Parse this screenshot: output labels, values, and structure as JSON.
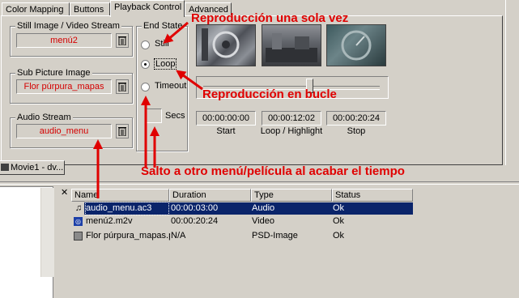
{
  "tabs": [
    {
      "label": "Color Mapping"
    },
    {
      "label": "Buttons"
    },
    {
      "label": "Playback Control"
    },
    {
      "label": "Advanced"
    }
  ],
  "groups": {
    "still": {
      "title": "Still Image / Video Stream",
      "value": "menú2"
    },
    "subpic": {
      "title": "Sub Picture Image",
      "value": "Flor púrpura_mapas"
    },
    "audio": {
      "title": "Audio Stream",
      "value": "audio_menu"
    }
  },
  "end_state": {
    "title": "End State",
    "options": [
      "Still",
      "Loop",
      "Timeout"
    ],
    "selected": "Loop",
    "secs_label": "Secs"
  },
  "times": {
    "start": {
      "value": "00:00:00:00",
      "label": "Start"
    },
    "loop": {
      "value": "00:00:12:02",
      "label": "Loop / Highlight"
    },
    "stop": {
      "value": "00:00:20:24",
      "label": "Stop"
    }
  },
  "slider": {
    "position_fraction": 0.6
  },
  "window_tab": {
    "label": "Movie1 - dv..."
  },
  "table": {
    "columns": [
      "Name",
      "Duration",
      "Type",
      "Status"
    ],
    "rows": [
      {
        "icon": "audio-file-icon",
        "name": "audio_menu.ac3",
        "duration": "00:00:03:00",
        "type": "Audio",
        "status": "Ok"
      },
      {
        "icon": "video-file-icon",
        "name": "menú2.m2v",
        "duration": "00:00:20:24",
        "type": "Video",
        "status": "Ok"
      },
      {
        "icon": "image-file-icon",
        "name": "Flor púrpura_mapas.psd",
        "duration": "N/A",
        "type": "PSD-Image",
        "status": "Ok"
      }
    ]
  },
  "annotations": {
    "single": "Reproducción una sola vez",
    "loop": "Reproducción en bucle",
    "timeout": "Salto a otro menú/película al acabar el tiempo"
  },
  "colors": {
    "annotation": "#e00000",
    "selection": "#0a246a",
    "field_text": "#d40000",
    "background": "#d4d0c8"
  }
}
